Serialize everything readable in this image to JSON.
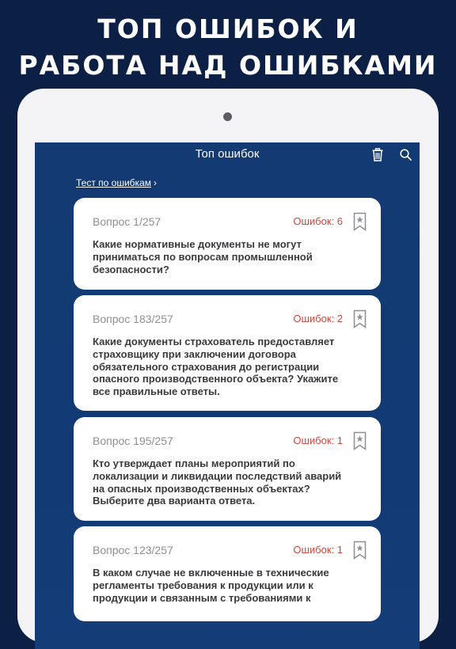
{
  "promo": {
    "line1": "ТОП ОШИБОК И",
    "line2": "РАБОТА НАД ОШИБКАМИ"
  },
  "navbar": {
    "title": "Топ ошибок",
    "trash_icon": "trash-icon",
    "search_icon": "search-icon"
  },
  "test_link": "Тест по ошибкам",
  "cards": [
    {
      "number": "Вопрос 1/257",
      "errors": "Ошибок: 6",
      "text": "Какие нормативные документы не могут приниматься по вопросам промышленной безопасности?"
    },
    {
      "number": "Вопрос 183/257",
      "errors": "Ошибок: 2",
      "text": "Какие документы страхователь предоставляет страховщику при заключении договора обязательного страхования до регистрации опасного производственного объекта? Укажите все правильные ответы."
    },
    {
      "number": "Вопрос 195/257",
      "errors": "Ошибок: 1",
      "text": "Кто утверждает планы мероприятий по локализации и ликвидации последствий аварий на опасных производственных объектах? Выберите два варианта ответа."
    },
    {
      "number": "Вопрос 123/257",
      "errors": "Ошибок: 1",
      "text": "В каком случае не включенные в технические регламенты требования к продукции или к продукции и связанным с требованиями к"
    }
  ],
  "colors": {
    "background": "#0c2045",
    "screen": "#133a72",
    "card": "#ffffff",
    "error_text": "#d0463c"
  }
}
